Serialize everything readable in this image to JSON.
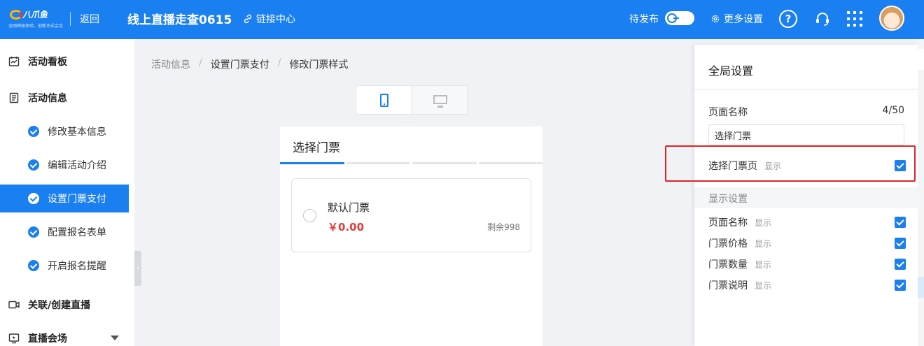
{
  "header": {
    "logo_brand": "八爪鱼",
    "logo_tagline": "全网神级体验，创新正式会议",
    "back_label": "返回",
    "event_title": "线上直播走查0615",
    "link_center_label": "链接中心",
    "pending_label": "待发布",
    "more_settings_label": "更多设置",
    "help_glyph": "?"
  },
  "sidebar": {
    "groups": [
      {
        "label": "活动看板",
        "icon": "dashboard-icon"
      },
      {
        "label": "活动信息",
        "icon": "document-icon"
      },
      {
        "label": "关联/创建直播",
        "icon": "video-icon"
      },
      {
        "label": "直播会场",
        "icon": "live-venue-icon"
      }
    ],
    "items": [
      {
        "label": "修改基本信息",
        "active": false
      },
      {
        "label": "编辑活动介绍",
        "active": false
      },
      {
        "label": "设置门票支付",
        "active": true
      },
      {
        "label": "配置报名表单",
        "active": false
      },
      {
        "label": "开启报名提醒",
        "active": false
      }
    ]
  },
  "breadcrumb": {
    "items": [
      "活动信息",
      "设置门票支付",
      "修改门票样式"
    ],
    "separator": "/"
  },
  "preview": {
    "title": "选择门票",
    "progress_steps": 4,
    "active_step": 1,
    "ticket": {
      "name": "默认门票",
      "price": "￥0.00",
      "remaining": "剩余998"
    }
  },
  "panel": {
    "title": "全局设置",
    "page_name_label": "页面名称",
    "page_name_count": "4/50",
    "page_name_value": "选择门票",
    "select_ticket_page_label": "选择门票页",
    "show_label": "显示",
    "display_settings_label": "显示设置",
    "display_rows": [
      {
        "label": "页面名称",
        "checked": true
      },
      {
        "label": "门票价格",
        "checked": true
      },
      {
        "label": "门票数量",
        "checked": true
      },
      {
        "label": "门票说明",
        "checked": true
      }
    ]
  },
  "colors": {
    "primary": "#1a7ff0",
    "price": "#e83b3b",
    "highlight": "#e02525"
  }
}
